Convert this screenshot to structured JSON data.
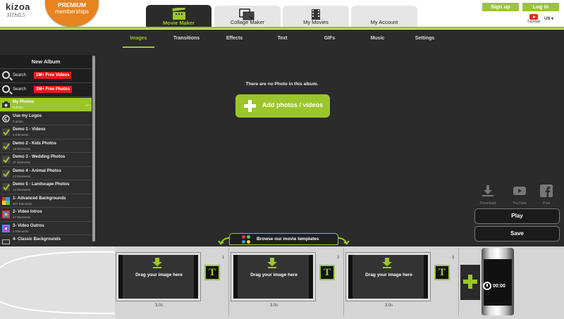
{
  "header": {
    "logo_text": "kizoa",
    "logo_sub": "HTML5",
    "premium_line1": "PREMIUM",
    "premium_line2": "memberships",
    "tabs": [
      {
        "label": "Movie Maker",
        "active": true
      },
      {
        "label": "Collage Maker",
        "active": false
      },
      {
        "label": "My Movies",
        "active": false
      },
      {
        "label": "My Account",
        "active": false
      }
    ],
    "signup_label": "Sign up",
    "login_label": "Log in",
    "tutorials_label": "Tutorials",
    "language": "US"
  },
  "subtabs": [
    {
      "label": "Images",
      "active": true
    },
    {
      "label": "Transitions"
    },
    {
      "label": "Effects"
    },
    {
      "label": "Text"
    },
    {
      "label": "GIFs"
    },
    {
      "label": "Music"
    },
    {
      "label": "Settings"
    }
  ],
  "sidebar": {
    "new_album_label": "New Album",
    "searches": [
      {
        "label": "Search",
        "badge": "1M+ Free Videos"
      },
      {
        "label": "Search",
        "badge": "3M+ Free Photos"
      }
    ],
    "albums": [
      {
        "name": "My Photos",
        "count": "0 photo",
        "selected": true,
        "icon": "camera-icon"
      },
      {
        "name": "Use my Logos",
        "count": "0 photo",
        "icon": "copyright-icon"
      },
      {
        "name": "Demo 1 - Videos",
        "count": "6 Elements",
        "icon": "check-icon"
      },
      {
        "name": "Demo 2 - Kids Photos",
        "count": "19 Elements",
        "icon": "check-icon"
      },
      {
        "name": "Demo 3 - Wedding Photos",
        "count": "27 Elements",
        "icon": "check-icon"
      },
      {
        "name": "Demo 4 - Animal Photos",
        "count": "22 Elements",
        "icon": "check-icon"
      },
      {
        "name": "Demo 5 - Landscape Photos",
        "count": "14 Elements",
        "icon": "check-icon"
      },
      {
        "name": "1- Advanced Backgrounds",
        "count": "207 Elements",
        "icon": "colorful-icon"
      },
      {
        "name": "2- Video Intros",
        "count": "47 Elements",
        "icon": "colorful-icon"
      },
      {
        "name": "3- Video Outros",
        "count": "5 Elements",
        "icon": "colorful-icon"
      },
      {
        "name": "4- Classic Backgrounds",
        "count": "",
        "icon": "film-icon"
      }
    ]
  },
  "main": {
    "empty_message": "There are no Photo in this album.",
    "add_button_label": "Add photos / videos"
  },
  "share": [
    {
      "label": "Download",
      "icon": "download-icon"
    },
    {
      "label": "YouTube",
      "icon": "youtube-icon"
    },
    {
      "label": "Post",
      "icon": "facebook-icon"
    }
  ],
  "actions": {
    "play_label": "Play",
    "save_label": "Save"
  },
  "browse_templates_label": "Browse our movie templates",
  "timeline": {
    "slots": [
      {
        "number": "1",
        "drag_label": "Drag your image here",
        "duration": "3.0s"
      },
      {
        "number": "2",
        "drag_label": "Drag your image here",
        "duration": "3.0s"
      },
      {
        "number": "3",
        "drag_label": "Drag your image here",
        "duration": "3.0s"
      }
    ],
    "text_button": "T",
    "total_time": "00:00"
  },
  "colors": {
    "accent": "#9bc62b",
    "premium": "#e8831f",
    "badge": "#e31b1b"
  }
}
